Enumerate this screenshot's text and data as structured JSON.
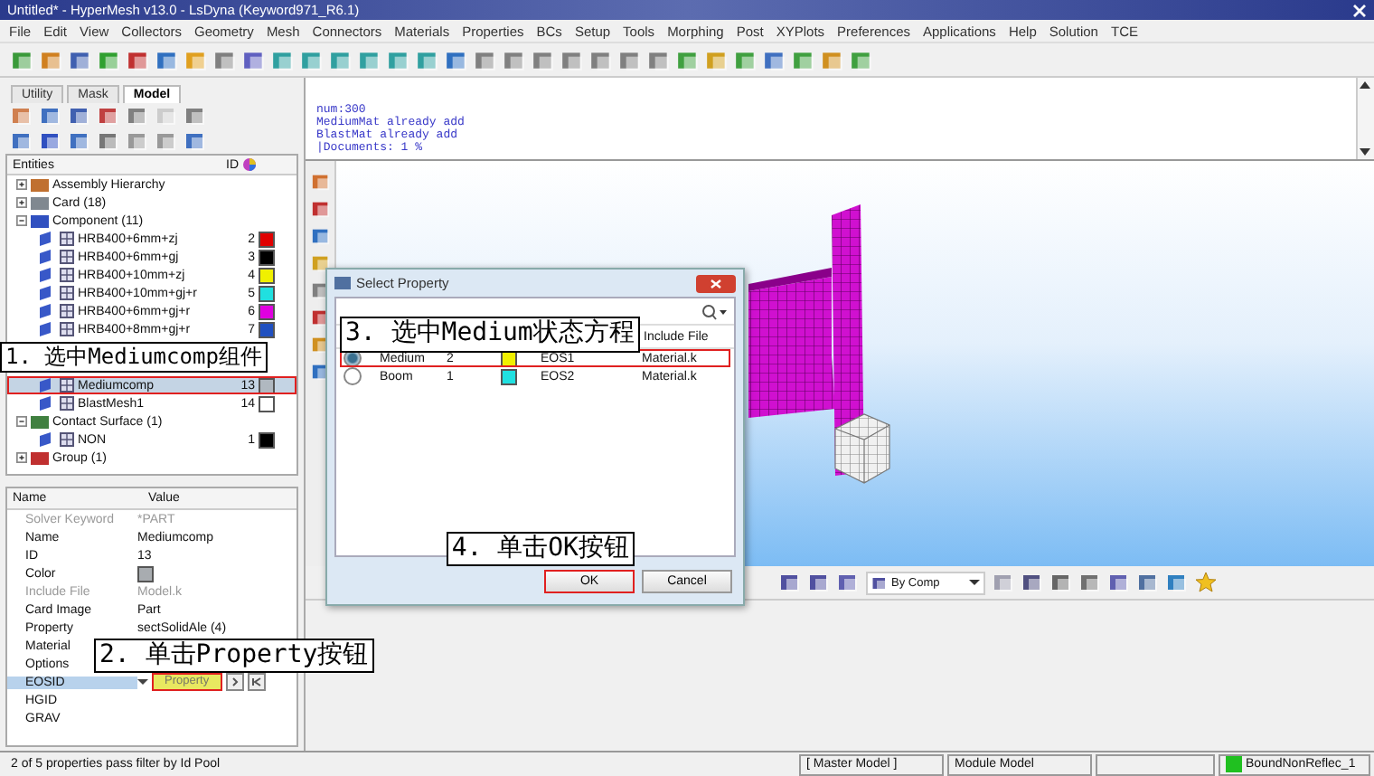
{
  "window": {
    "title": "Untitled* - HyperMesh v13.0 - LsDyna (Keyword971_R6.1)"
  },
  "menu": [
    "File",
    "Edit",
    "View",
    "Collectors",
    "Geometry",
    "Mesh",
    "Connectors",
    "Materials",
    "Properties",
    "BCs",
    "Setup",
    "Tools",
    "Morphing",
    "Post",
    "XYPlots",
    "Preferences",
    "Applications",
    "Help",
    "Solution",
    "TCE"
  ],
  "left_panel": {
    "tabs": [
      {
        "label": "Utility",
        "selected": false
      },
      {
        "label": "Mask",
        "selected": false
      },
      {
        "label": "Model",
        "selected": true
      }
    ],
    "entities_header": {
      "name": "Entities",
      "id": "ID"
    },
    "tree": [
      {
        "label": "Assembly Hierarchy",
        "kind": "assembly",
        "expanded": false
      },
      {
        "label": "Card (18)",
        "kind": "card",
        "expanded": false
      },
      {
        "label": "Component (11)",
        "kind": "component",
        "expanded": true,
        "children": [
          {
            "label": "HRB400+6mm+zj",
            "id": "2",
            "color": "#e00000",
            "selected": false
          },
          {
            "label": "HRB400+6mm+gj",
            "id": "3",
            "color": "#000000",
            "selected": false
          },
          {
            "label": "HRB400+10mm+zj",
            "id": "4",
            "color": "#f0f000",
            "selected": false
          },
          {
            "label": "HRB400+10mm+gj+r",
            "id": "5",
            "color": "#20e0e0",
            "selected": false
          },
          {
            "label": "HRB400+6mm+gj+r",
            "id": "6",
            "color": "#e000e0",
            "selected": false
          },
          {
            "label": "HRB400+8mm+gj+r",
            "id": "7",
            "color": "#2050c0",
            "selected": false
          },
          {
            "label": "Mediumcomp",
            "id": "13",
            "color": "#b0b8c0",
            "selected": true,
            "highlighted": true,
            "callout": "1. 选中Mediumcomp组件"
          },
          {
            "label": "BlastMesh1",
            "id": "14",
            "color": "#ffffff",
            "selected": false
          }
        ]
      },
      {
        "label": "Contact Surface (1)",
        "kind": "contact",
        "expanded": true,
        "children": [
          {
            "label": "NON",
            "id": "1",
            "color": "#000000",
            "selected": false
          }
        ]
      },
      {
        "label": "Group (1)",
        "kind": "group",
        "expanded": false
      }
    ],
    "properties": {
      "columns": [
        "Name",
        "Value"
      ],
      "rows": [
        {
          "name": "Solver Keyword",
          "value": "*PART",
          "disabled": true
        },
        {
          "name": "Name",
          "value": "Mediumcomp",
          "disabled": false
        },
        {
          "name": "ID",
          "value": "13",
          "disabled": false
        },
        {
          "name": "Color",
          "color": "#a8acb0",
          "disabled": false
        },
        {
          "name": "Include File",
          "value": "Model.k",
          "disabled": true
        },
        {
          "name": "Card Image",
          "value": "Part",
          "disabled": false
        },
        {
          "name": "Property",
          "value": "sectSolidAle (4)",
          "disabled": false
        },
        {
          "name": "Material",
          "disabled": false
        },
        {
          "name": "Options",
          "disabled": false
        },
        {
          "name": "EOSID",
          "disabled": false,
          "selected": true,
          "button": {
            "label": "Property",
            "highlighted": true,
            "callout": "2. 单击Property按钮"
          }
        },
        {
          "name": "HGID",
          "disabled": false
        },
        {
          "name": "GRAV",
          "disabled": false
        }
      ]
    }
  },
  "console": {
    "lines": [
      "num:300",
      "MediumMat already add",
      "BlastMat already add",
      "|Documents: 1 %"
    ]
  },
  "graphics_toolbar": {
    "display_mode": "By Comp"
  },
  "dialog": {
    "title": "Select Property",
    "header_callout": "3. 选中Medium状态方程",
    "columns": [
      "Include File"
    ],
    "rows": [
      {
        "name": "Medium",
        "id": "2",
        "color": "#f0f000",
        "card_image": "EOS1",
        "include_file": "Material.k",
        "selected": true,
        "highlighted": true
      },
      {
        "name": "Boom",
        "id": "1",
        "color": "#20e0e0",
        "card_image": "EOS2",
        "include_file": "Material.k",
        "selected": false,
        "highlighted": false
      }
    ],
    "buttons": [
      {
        "label": "OK",
        "highlighted": true,
        "callout": "4. 单击OK按钮"
      },
      {
        "label": "Cancel",
        "highlighted": false
      }
    ]
  },
  "status_bar": {
    "message": "2 of 5 properties pass filter by Id Pool",
    "panels": [
      "[ Master Model ]",
      "Module Model"
    ],
    "active": {
      "label": "BoundNonReflec_1",
      "color": "#20c020"
    }
  }
}
